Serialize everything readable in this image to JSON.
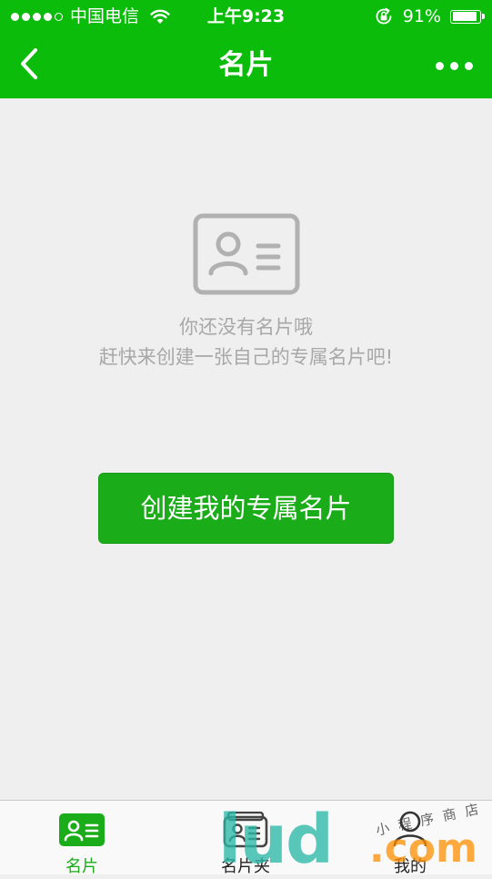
{
  "status_bar": {
    "carrier": "中国电信",
    "time": "上午9:23",
    "battery": "91%",
    "battery_level": 0.91
  },
  "nav": {
    "title": "名片"
  },
  "empty_state": {
    "line1": "你还没有名片哦",
    "line2": "赶快来创建一张自己的专属名片吧!"
  },
  "create_button": {
    "label": "创建我的专属名片"
  },
  "tabs": [
    {
      "label": "名片",
      "icon": "business-card-icon",
      "active": true
    },
    {
      "label": "名片夹",
      "icon": "card-holder-icon",
      "active": false
    },
    {
      "label": "我的",
      "icon": "person-icon",
      "active": false
    }
  ],
  "watermark": {
    "brand": "lud",
    "domain": ".com",
    "caption": "小程序商店"
  },
  "colors": {
    "primary_green": "#0bbc0b",
    "button_green": "#1aad19",
    "muted_text": "#a8a8a8",
    "background": "#efefef"
  }
}
